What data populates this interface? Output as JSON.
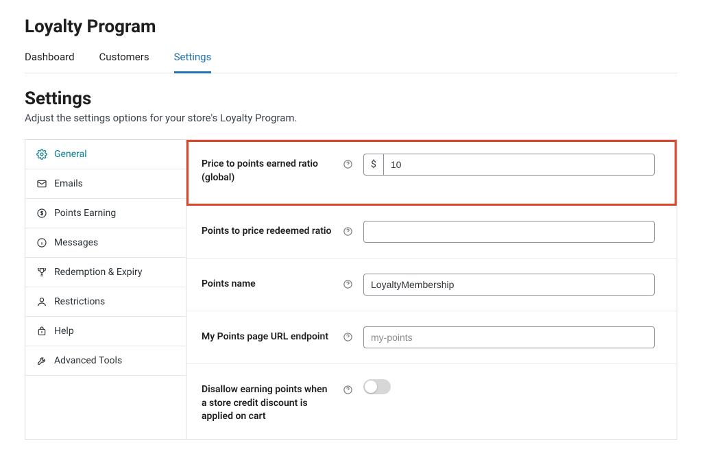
{
  "page_title": "Loyalty Program",
  "tabs": [
    "Dashboard",
    "Customers",
    "Settings"
  ],
  "active_tab": 2,
  "section": {
    "title": "Settings",
    "desc": "Adjust the settings options for your store's Loyalty Program."
  },
  "sidebar": {
    "items": [
      {
        "label": "General",
        "icon": "gear-icon"
      },
      {
        "label": "Emails",
        "icon": "mail-icon"
      },
      {
        "label": "Points Earning",
        "icon": "dollar-circle-icon"
      },
      {
        "label": "Messages",
        "icon": "info-icon"
      },
      {
        "label": "Redemption & Expiry",
        "icon": "trophy-icon"
      },
      {
        "label": "Restrictions",
        "icon": "user-icon"
      },
      {
        "label": "Help",
        "icon": "bag-icon"
      },
      {
        "label": "Advanced Tools",
        "icon": "tools-icon"
      }
    ],
    "active": 0
  },
  "fields": {
    "price_to_points": {
      "label": "Price to points earned ratio (global)",
      "prefix": "$",
      "value": "10"
    },
    "points_to_price": {
      "label": "Points to price redeemed ratio",
      "value": ""
    },
    "points_name": {
      "label": "Points name",
      "value": "LoyaltyMembership"
    },
    "url_endpoint": {
      "label": "My Points page URL endpoint",
      "placeholder": "my-points",
      "value": ""
    },
    "disallow_earning": {
      "label": "Disallow earning points when a store credit discount is applied on cart",
      "value": false
    }
  }
}
